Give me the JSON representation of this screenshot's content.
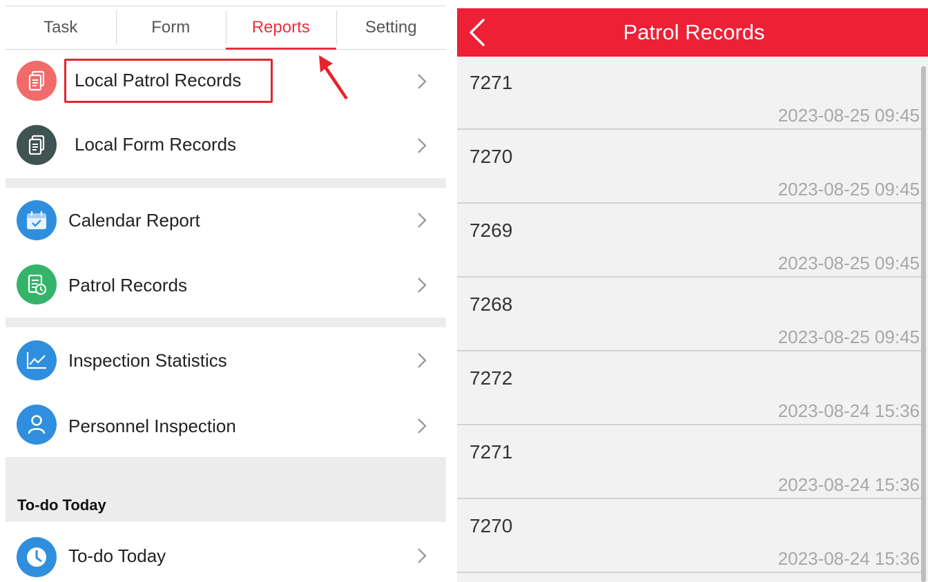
{
  "left_screen": {
    "tabs": [
      {
        "label": "Task",
        "active": false
      },
      {
        "label": "Form",
        "active": false
      },
      {
        "label": "Reports",
        "active": true
      },
      {
        "label": "Setting",
        "active": false
      }
    ],
    "menu": {
      "local_patrol_records": "Local Patrol Records",
      "local_form_records": "Local Form Records",
      "calendar_report": "Calendar Report",
      "patrol_records": "Patrol Records",
      "inspection_statistics": "Inspection Statistics",
      "personnel_inspection": "Personnel Inspection",
      "todo_today": "To-do Today"
    },
    "section_title": "To-do Today",
    "colors": {
      "accent": "#e8303c",
      "icon_local_patrol": "#f26a6a",
      "icon_local_form": "#3f5450",
      "icon_calendar": "#2f8fde",
      "icon_patrol": "#34b46a",
      "icon_inspection": "#2f8fde",
      "icon_personnel": "#2f8fde",
      "icon_todo": "#2f8fde"
    }
  },
  "right_screen": {
    "title": "Patrol Records",
    "header_color": "#ee2036",
    "records": [
      {
        "id": "7271",
        "time": "2023-08-25 09:45"
      },
      {
        "id": "7270",
        "time": "2023-08-25 09:45"
      },
      {
        "id": "7269",
        "time": "2023-08-25 09:45"
      },
      {
        "id": "7268",
        "time": "2023-08-25 09:45"
      },
      {
        "id": "7272",
        "time": "2023-08-24 15:36"
      },
      {
        "id": "7271",
        "time": "2023-08-24 15:36"
      },
      {
        "id": "7270",
        "time": "2023-08-24 15:36"
      }
    ]
  }
}
